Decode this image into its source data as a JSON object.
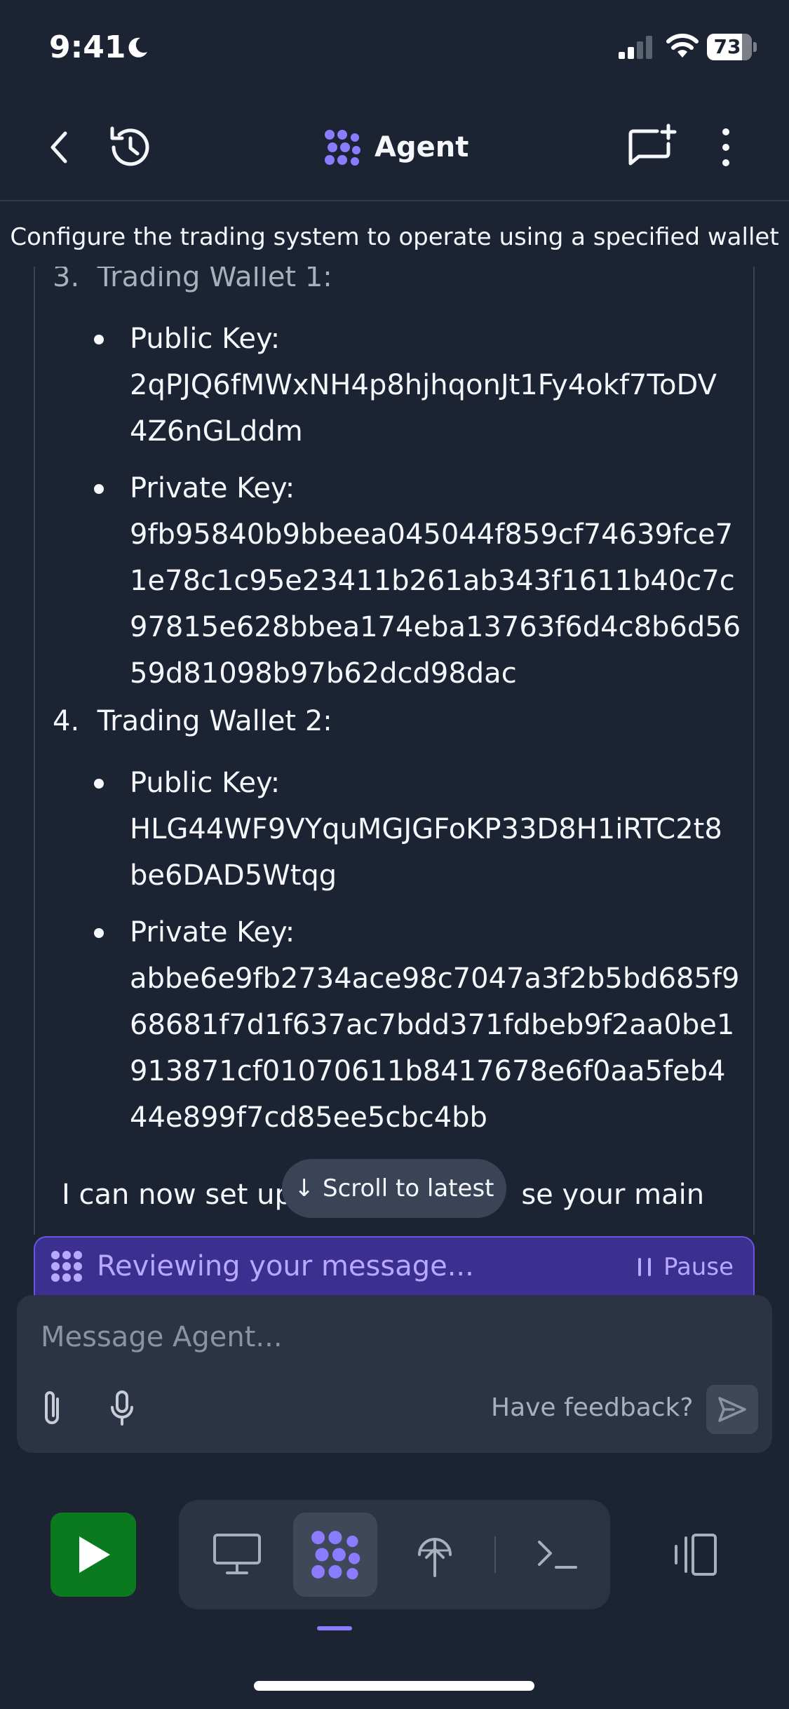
{
  "status_bar": {
    "time": "9:41",
    "battery": "73"
  },
  "header": {
    "title": "Agent"
  },
  "chat": {
    "task_title": "Configure the trading system to operate using a specified wallet",
    "items": [
      {
        "number": "3.",
        "label": "Trading Wallet 1:",
        "bullets": [
          {
            "text": "Public Key:\n2qPJQ6fMWxNH4p8hjhqonJt1Fy4okf7ToDV\n4Z6nGLddm"
          },
          {
            "text": "Private Key:\n9fb95840b9bbeea045044f859cf74639fce7\n1e78c1c95e23411b261ab343f1611b40c7c\n97815e628bbea174eba13763f6d4c8b6d56\n59d81098b97b62dcd98dac"
          }
        ]
      },
      {
        "number": "4.",
        "label": "Trading Wallet 2:",
        "bullets": [
          {
            "text": "Public Key:\nHLG44WF9VYquMGJGFoKP33D8H1iRTC2t8\nbe6DAD5Wtqg"
          },
          {
            "text": "Private Key:\nabbe6e9fb2734ace98c7047a3f2b5bd685f9\n68681f7d1f637ac7bdd371fdbeb9f2aa0be1\n913871cf01070611b8417678e6f0aa5feb4\n44e899f7cd85ee5cbc4bb"
          }
        ]
      }
    ],
    "message_start": "I can now set up y",
    "message_end": "se your main",
    "scroll_to_latest": "Scroll to latest"
  },
  "review_banner": {
    "text": "Reviewing your message...",
    "pause_label": "Pause"
  },
  "composer": {
    "placeholder": "Message Agent...",
    "feedback_label": "Have feedback?"
  },
  "colors": {
    "accent": "#8b7bff",
    "run_green": "#0b7a1e",
    "background": "#1c2333"
  }
}
